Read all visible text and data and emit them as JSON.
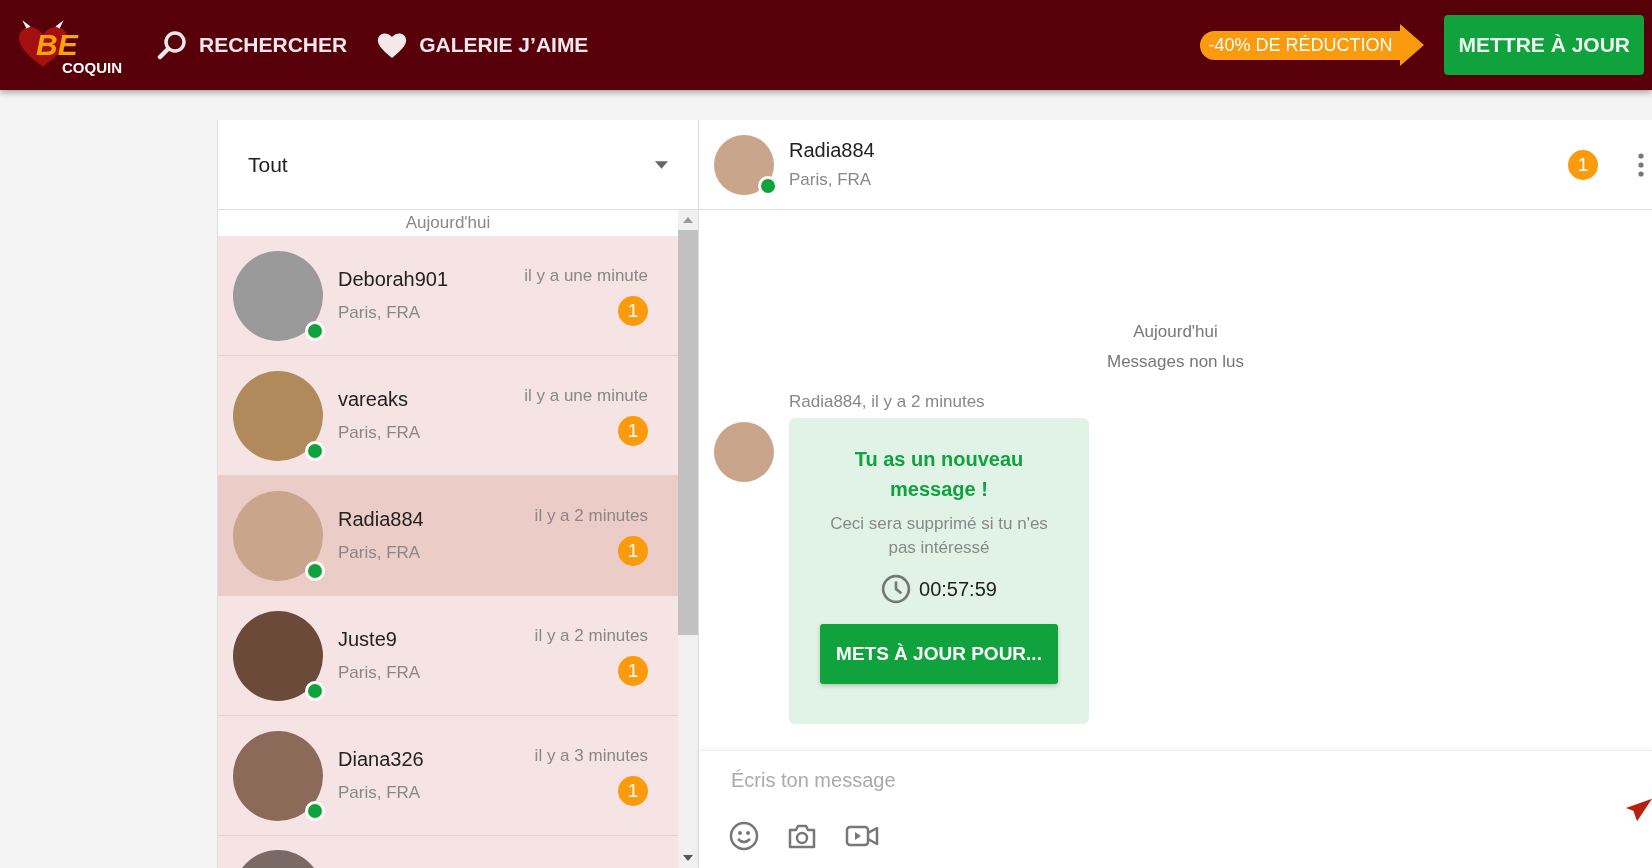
{
  "header": {
    "logo": {
      "big": "BE",
      "small": "COQUIN"
    },
    "nav": [
      {
        "label": "RECHERCHER",
        "kind": "search"
      },
      {
        "label": "GALERIE J’AIME",
        "kind": "favorites"
      }
    ],
    "promo": "-40% DE RÉDUCTION",
    "upgrade_button": "METTRE À JOUR"
  },
  "sidebar": {
    "filter": "Tout",
    "date_label": "Aujourd'hui",
    "conversations": [
      {
        "name": "Deborah901",
        "location": "Paris, FRA",
        "time": "il y a une minute",
        "unread": "1",
        "online": true,
        "selected": false
      },
      {
        "name": "vareaks",
        "location": "Paris, FRA",
        "time": "il y a une minute",
        "unread": "1",
        "online": true,
        "selected": false
      },
      {
        "name": "Radia884",
        "location": "Paris, FRA",
        "time": "il y a 2 minutes",
        "unread": "1",
        "online": true,
        "selected": true
      },
      {
        "name": "Juste9",
        "location": "Paris, FRA",
        "time": "il y a 2 minutes",
        "unread": "1",
        "online": true,
        "selected": false
      },
      {
        "name": "Diana326",
        "location": "Paris, FRA",
        "time": "il y a 3 minutes",
        "unread": "1",
        "online": true,
        "selected": false
      }
    ]
  },
  "chat": {
    "contact": {
      "name": "Radia884",
      "location": "Paris, FRA",
      "online": true,
      "unread": "1"
    },
    "day_label": "Aujourd'hui",
    "unread_label": "Messages non lus",
    "message": {
      "meta": "Radia884, il y a 2 minutes",
      "title": "Tu as un nouveau message !",
      "text": "Ceci sera supprimé si tu n'es pas intéressé",
      "timer": "00:57:59",
      "button": "METS À JOUR POUR..."
    },
    "composer": {
      "placeholder": "Écris ton message"
    }
  }
}
